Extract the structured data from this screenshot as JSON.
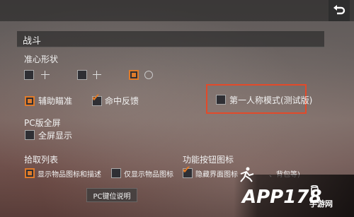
{
  "header": {
    "back_icon": "return-arrow-icon"
  },
  "section": {
    "title": "战斗"
  },
  "crosshair": {
    "title": "准心形状",
    "options": [
      {
        "icon": "thin-cross-crosshair-icon",
        "checked": false
      },
      {
        "icon": "cross-crosshair-icon",
        "checked": false
      },
      {
        "icon": "circle-crosshair-icon",
        "checked": true
      }
    ]
  },
  "options": {
    "aim_assist": "辅助瞄准",
    "hit_feedback": "命中反馈",
    "first_person": "第一人称模式(测试版)"
  },
  "pc_fullscreen": {
    "title": "PC版全屏",
    "option": "全屏显示"
  },
  "pickup": {
    "title": "拾取列表",
    "opt1": "显示物品图标和描述",
    "opt2": "仅显示物品图标"
  },
  "function_icons": {
    "title": "功能按钮图标",
    "opt1": "隐藏界面图标",
    "opt1_tail": "、背包等)"
  },
  "keybind_button": "PC键位说明",
  "watermark": {
    "app": "APP178",
    "cn": "手游网"
  },
  "colors": {
    "accent": "#e07b2a",
    "highlight": "#e24a2a"
  }
}
